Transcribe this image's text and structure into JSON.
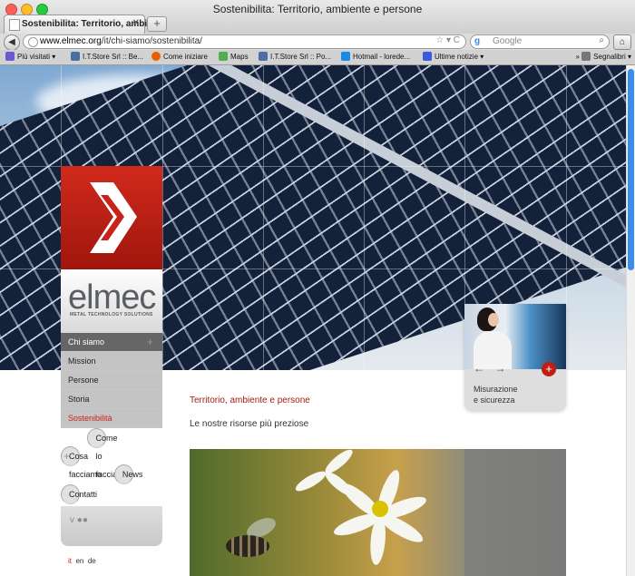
{
  "window": {
    "title": "Sostenibilita: Territorio, ambiente e persone",
    "tab_label": "Sostenibilita: Territorio, ambien...",
    "tab_close": "✕",
    "new_tab": "+"
  },
  "navbar": {
    "back": "◀",
    "url_host": "www.elmec.org",
    "url_path": "/it/chi-siamo/sostenibilita/",
    "url_icons": "☆ ▾ C",
    "search_engine": "g",
    "search_placeholder": "Google",
    "search_icon": "⌕",
    "home_icon": "⌂"
  },
  "bookmarks": {
    "items": [
      {
        "label": "Più visitati ▾",
        "color": "#6a5acd"
      },
      {
        "label": "I.T.Store Srl :: Be...",
        "color": "#4a6fa5"
      },
      {
        "label": "Come iniziare",
        "color": "#e66000"
      },
      {
        "label": "Maps",
        "color": "#4caf50"
      },
      {
        "label": "I.T.Store Srl :: Po...",
        "color": "#4a6fa5"
      },
      {
        "label": "Hotmail - lorede...",
        "color": "#1e88e5"
      },
      {
        "label": "Ultime notizie ▾",
        "color": "#3b5bdb"
      }
    ],
    "overflow": "»",
    "right_label": "Segnalibri ▾"
  },
  "brand": {
    "name": "elmec",
    "tagline": "METAL TECHNOLOGY SOLUTIONS",
    "primary_color": "#c8221a"
  },
  "menu": {
    "items": [
      {
        "label": "Chi siamo",
        "plus": "+"
      },
      {
        "label": "Mission"
      },
      {
        "label": "Persone"
      },
      {
        "label": "Storia"
      },
      {
        "label": "Sostenibilità"
      },
      {
        "label": "Cosa facciamo",
        "plus": "+"
      },
      {
        "label": "Come lo facciamo"
      },
      {
        "label": "News"
      },
      {
        "label": "Contatti"
      }
    ],
    "social": "v ●●",
    "languages": {
      "current": "it",
      "others": [
        "en",
        "de"
      ]
    }
  },
  "content": {
    "title": "Territorio, ambiente e persone",
    "subtitle": "Le nostre risorse più preziose"
  },
  "card": {
    "arrows": "← →",
    "plus": "+",
    "line1": "Misurazione",
    "line2": "e sicurezza"
  }
}
